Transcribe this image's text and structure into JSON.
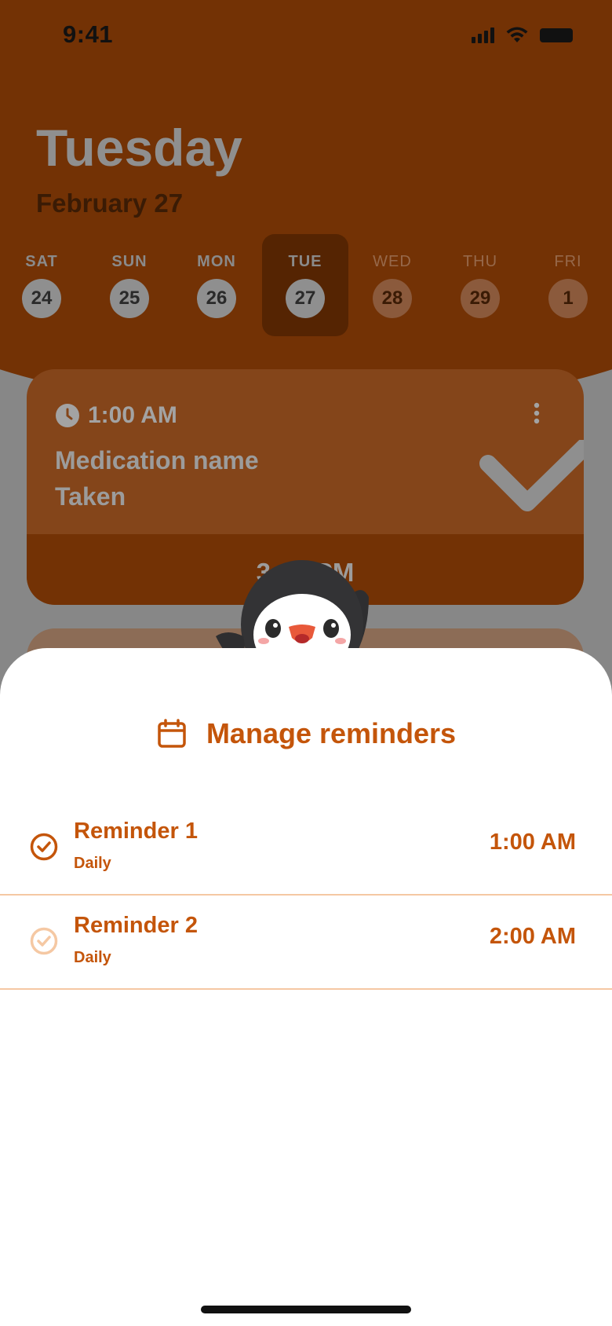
{
  "status_bar": {
    "time": "9:41"
  },
  "header": {
    "day": "Tuesday",
    "date": "February 27"
  },
  "week": [
    {
      "label": "SAT",
      "num": "24",
      "state": "past"
    },
    {
      "label": "SUN",
      "num": "25",
      "state": "past"
    },
    {
      "label": "MON",
      "num": "26",
      "state": "past"
    },
    {
      "label": "TUE",
      "num": "27",
      "state": "selected"
    },
    {
      "label": "WED",
      "num": "28",
      "state": "future"
    },
    {
      "label": "THU",
      "num": "29",
      "state": "future"
    },
    {
      "label": "FRI",
      "num": "1",
      "state": "future"
    }
  ],
  "med_card": {
    "time": "1:00 AM",
    "name": "Medication name",
    "status": "Taken",
    "next_time": "3:00 PM"
  },
  "sheet": {
    "title": "Manage reminders",
    "icon": "calendar-icon",
    "reminders": [
      {
        "name": "Reminder 1",
        "frequency": "Daily",
        "time": "1:00 AM",
        "active": true
      },
      {
        "name": "Reminder 2",
        "frequency": "Daily",
        "time": "2:00 AM",
        "active": false
      }
    ]
  },
  "colors": {
    "accent": "#c4550a",
    "header_bg": "#733205",
    "divider": "#f5c8a3"
  }
}
